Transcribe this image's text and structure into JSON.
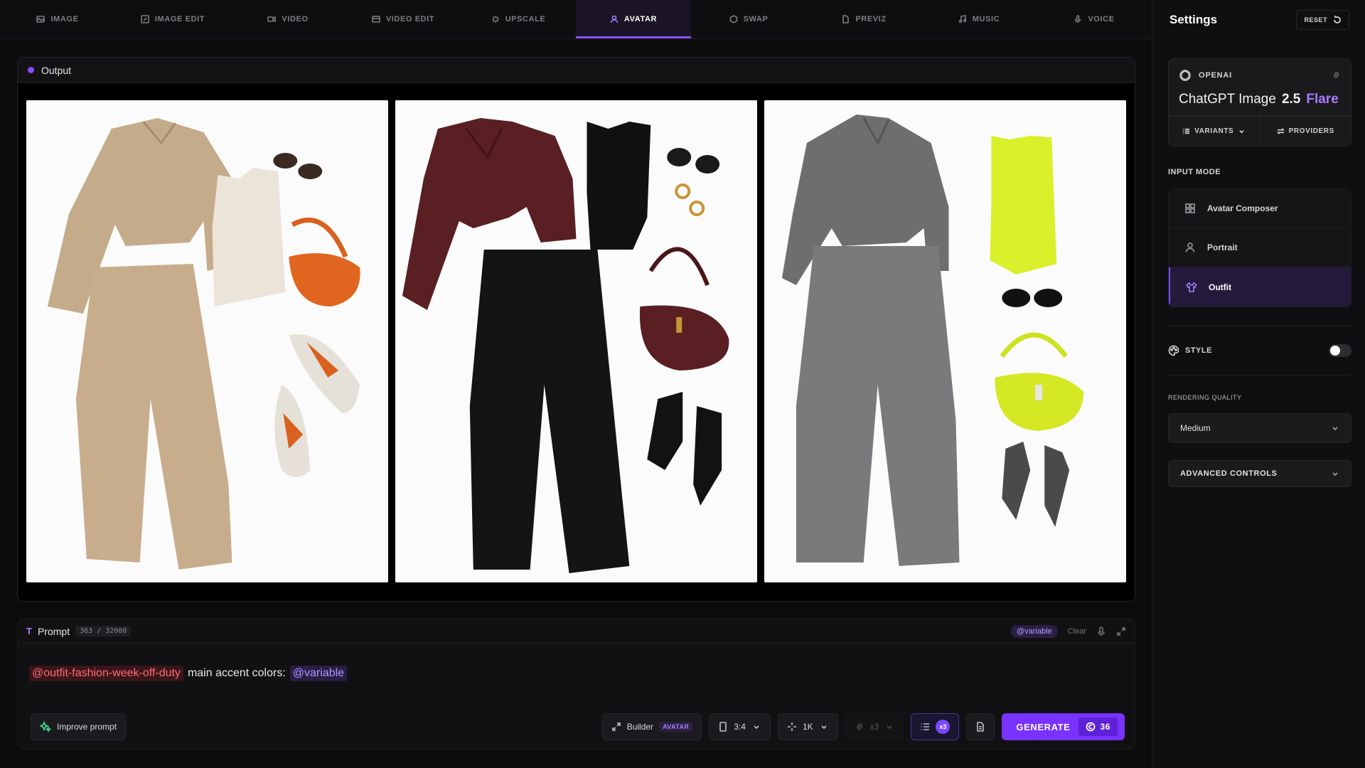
{
  "nav": {
    "tabs": [
      {
        "label": "IMAGE",
        "icon": "image-icon"
      },
      {
        "label": "IMAGE EDIT",
        "icon": "edit-icon"
      },
      {
        "label": "VIDEO",
        "icon": "video-icon"
      },
      {
        "label": "VIDEO EDIT",
        "icon": "video-edit-icon"
      },
      {
        "label": "UPSCALE",
        "icon": "sparkle-icon"
      },
      {
        "label": "AVATAR",
        "icon": "user-icon"
      },
      {
        "label": "SWAP",
        "icon": "swap-icon"
      },
      {
        "label": "PREVIZ",
        "icon": "file-icon"
      },
      {
        "label": "MUSIC",
        "icon": "music-icon"
      },
      {
        "label": "VOICE",
        "icon": "mic-icon"
      }
    ],
    "active_index": 5
  },
  "output": {
    "title": "Output",
    "images": [
      {
        "icon": "outfit-image-beige",
        "accent": "#c8ad8c"
      },
      {
        "icon": "outfit-image-burgundy",
        "accent": "#5a1f22"
      },
      {
        "icon": "outfit-image-grey",
        "accent": "#7a7a7c"
      }
    ]
  },
  "prompt": {
    "title": "Prompt",
    "counter": "363 / 32000",
    "variable_chip": "@variable",
    "clear_label": "Clear",
    "text_tag": "@outfit-fashion-week-off-duty",
    "text_middle": "main accent colors:",
    "text_variable": "@variable",
    "improve_label": "Improve prompt"
  },
  "toolbar": {
    "builder_label": "Builder",
    "builder_badge": "AVATAR",
    "aspect": "3:4",
    "resolution": "1K",
    "batch_disabled": "x3",
    "queue_count": "x3",
    "generate_label": "GENERATE",
    "credits": "36"
  },
  "settings": {
    "title": "Settings",
    "reset_label": "RESET",
    "provider": "OPENAI",
    "model_name": "ChatGPT Image",
    "model_version": "2.5",
    "model_flavor": "Flare",
    "variants_label": "VARIANTS",
    "providers_label": "PROVIDERS",
    "input_mode_label": "INPUT MODE",
    "modes": [
      {
        "label": "Avatar Composer",
        "icon": "grid-icon"
      },
      {
        "label": "Portrait",
        "icon": "person-icon"
      },
      {
        "label": "Outfit",
        "icon": "shirt-icon"
      }
    ],
    "active_mode": 2,
    "style_label": "STYLE",
    "rendering_quality_label": "RENDERING QUALITY",
    "rendering_quality_value": "Medium",
    "advanced_label": "ADVANCED CONTROLS"
  },
  "colors": {
    "accent": "#7a32ff",
    "accent_light": "#a77bff"
  }
}
